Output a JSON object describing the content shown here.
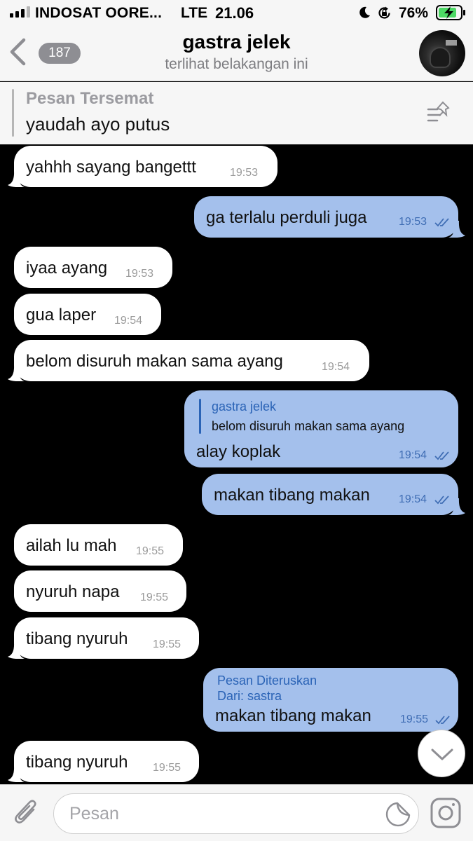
{
  "status_bar": {
    "carrier": "INDOSAT OORE...",
    "network": "LTE",
    "time": "21.06",
    "battery": "76%",
    "icons": [
      "signal-bars-icon",
      "moon-icon",
      "orientation-lock-icon",
      "battery-charging-icon"
    ]
  },
  "header": {
    "back_count": "187",
    "title": "gastra jelek",
    "subtitle": "terlihat belakangan ini",
    "icons": [
      "chevron-left-icon",
      "avatar"
    ]
  },
  "pinned": {
    "title": "Pesan Tersemat",
    "text": "yaudah ayo putus",
    "icon": "pin-list-icon"
  },
  "messages": [
    {
      "dir": "in",
      "text": "yahhh sayang bangettt",
      "time": "19:53",
      "tail": true
    },
    {
      "dir": "out",
      "text": "ga terlalu perduli juga",
      "time": "19:53",
      "tail": true
    },
    {
      "dir": "in",
      "text": "iyaa ayang",
      "time": "19:53",
      "tail": false
    },
    {
      "dir": "in",
      "text": "gua laper",
      "time": "19:54",
      "tail": false
    },
    {
      "dir": "in",
      "text": "belom disuruh makan sama ayang",
      "time": "19:54",
      "tail": true
    },
    {
      "dir": "out",
      "text": "alay koplak",
      "time": "19:54",
      "tail": false,
      "reply": {
        "name": "gastra jelek",
        "text": "belom disuruh makan sama ayang"
      }
    },
    {
      "dir": "out",
      "text": "makan tibang makan",
      "time": "19:54",
      "tail": true
    },
    {
      "dir": "in",
      "text": "ailah lu mah",
      "time": "19:55",
      "tail": false
    },
    {
      "dir": "in",
      "text": "nyuruh napa",
      "time": "19:55",
      "tail": false
    },
    {
      "dir": "in",
      "text": "tibang nyuruh",
      "time": "19:55",
      "tail": true
    },
    {
      "dir": "out",
      "text": "makan tibang makan",
      "time": "19:55",
      "tail": false,
      "forward": {
        "label": "Pesan Diteruskan",
        "from": "Dari: sastra"
      }
    },
    {
      "dir": "in",
      "text": "tibang nyuruh",
      "time": "19:55",
      "tail": true
    }
  ],
  "input": {
    "placeholder": "Pesan",
    "icons": [
      "paperclip-icon",
      "sticker-icon",
      "camera-icon",
      "chevron-down-icon"
    ]
  },
  "colors": {
    "chat_background": "#000000",
    "incoming_bubble": "#ffffff",
    "outgoing_bubble": "#a4c0ec",
    "accent": "#2a63b6",
    "bar_background": "#f6f6f6"
  }
}
